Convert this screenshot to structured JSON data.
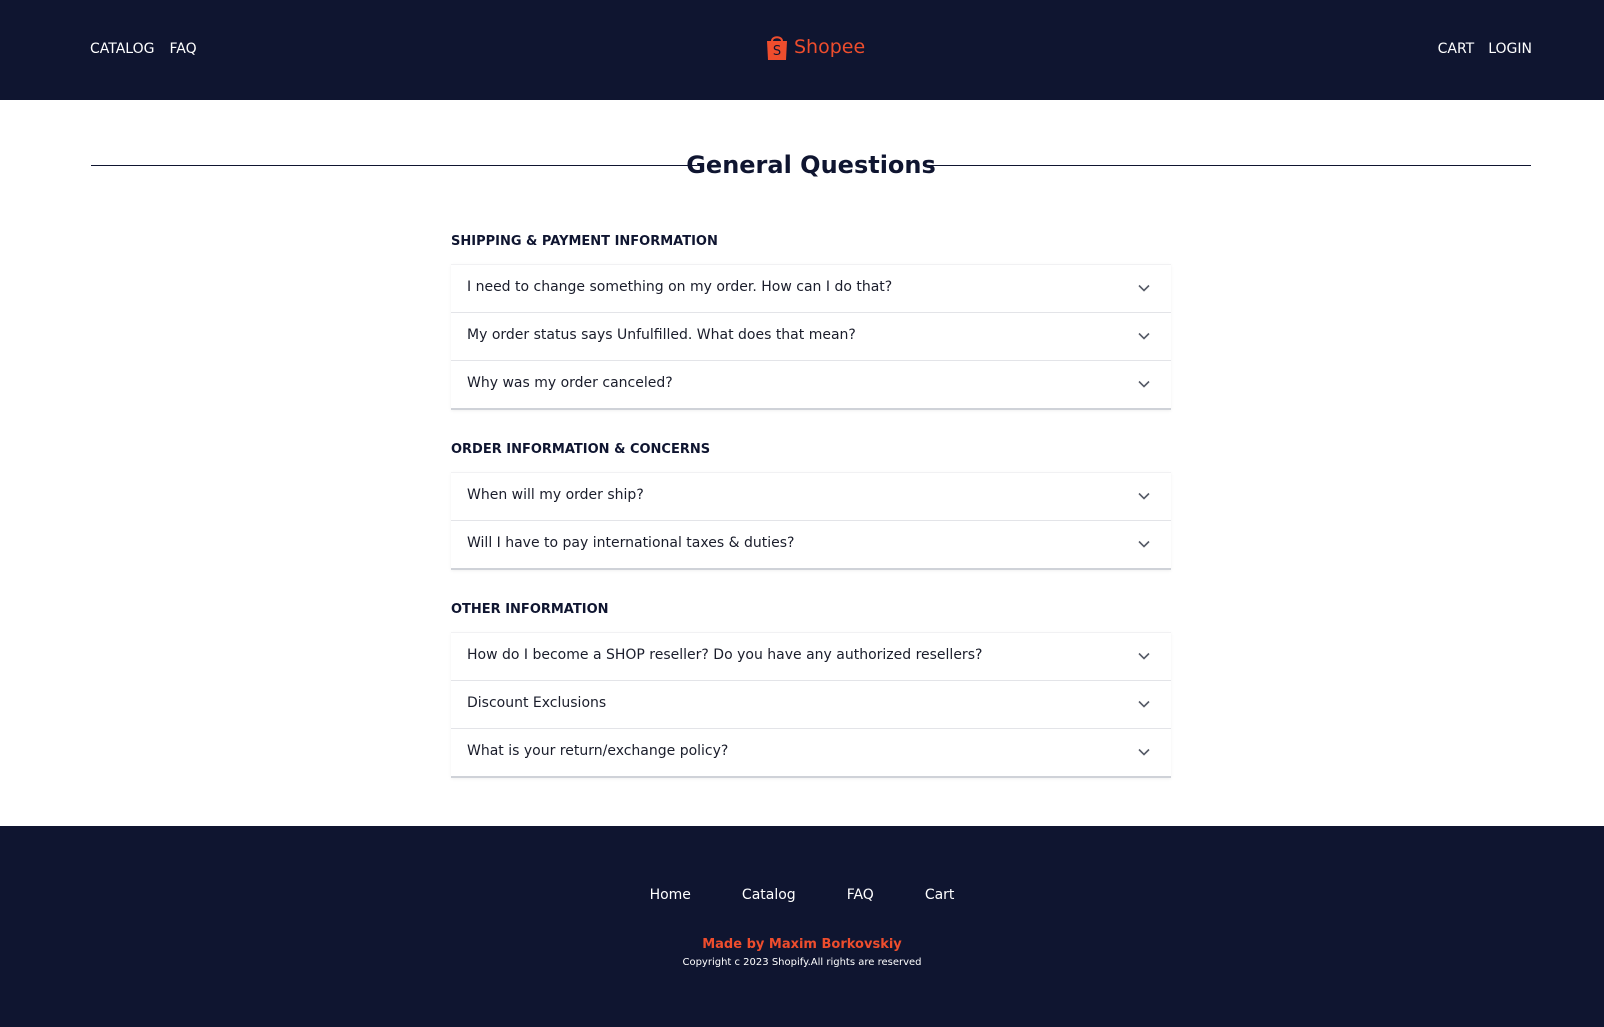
{
  "header": {
    "nav_left": [
      {
        "label": "CATALOG"
      },
      {
        "label": "FAQ"
      }
    ],
    "logo_text": "Shopee",
    "logo_bag_letter": "S",
    "nav_right": [
      {
        "label": "CART"
      },
      {
        "label": "LOGIN"
      }
    ]
  },
  "main": {
    "title": "General Questions",
    "sections": [
      {
        "title": "SHIPPING & PAYMENT INFORMATION",
        "questions": [
          "I need to change something on my order. How can I do that?",
          "My order status says Unfulfilled. What does that mean?",
          "Why was my order canceled?"
        ]
      },
      {
        "title": "ORDER INFORMATION & CONCERNS",
        "questions": [
          "When will my order ship?",
          "Will I have to pay international taxes & duties?"
        ]
      },
      {
        "title": "OTHER INFORMATION",
        "questions": [
          "How do I become a SHOP reseller? Do you have any authorized resellers?",
          "Discount Exclusions",
          "What is your return/exchange policy?"
        ]
      }
    ]
  },
  "footer": {
    "links": [
      {
        "label": "Home"
      },
      {
        "label": "Catalog"
      },
      {
        "label": "FAQ"
      },
      {
        "label": "Cart"
      }
    ],
    "credit": "Made by Maxim Borkovskiy",
    "copyright": "Copyright c 2023 Shopify.All rights are reserved"
  },
  "colors": {
    "header_bg": "#0f1530",
    "brand": "#ee4d2d",
    "text": "#0f1530"
  },
  "icons": {
    "logo": "shopping-bag-icon",
    "accordion": "chevron-down-icon"
  }
}
